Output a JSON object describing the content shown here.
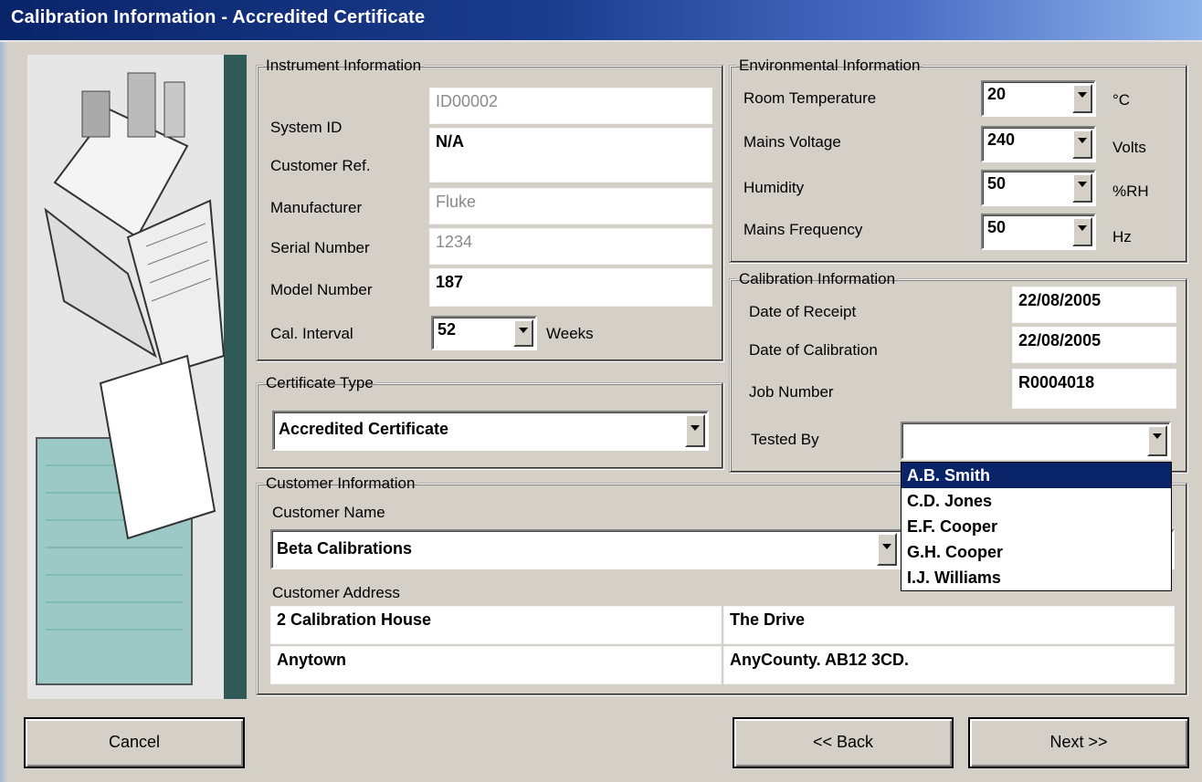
{
  "window": {
    "title": "Calibration Information - Accredited Certificate"
  },
  "instrument": {
    "legend": "Instrument Information",
    "system_id_label": "System ID",
    "system_id": "ID00002",
    "customer_ref_label": "Customer Ref.",
    "customer_ref": "N/A",
    "manufacturer_label": "Manufacturer",
    "manufacturer": "Fluke",
    "serial_label": "Serial Number",
    "serial": "1234",
    "model_label": "Model Number",
    "model": "187",
    "interval_label": "Cal. Interval",
    "interval": "52",
    "interval_unit": "Weeks"
  },
  "environment": {
    "legend": "Environmental Information",
    "temp_label": "Room Temperature",
    "temp": "20",
    "temp_unit": "°C",
    "voltage_label": "Mains Voltage",
    "voltage": "240",
    "voltage_unit": "Volts",
    "humidity_label": "Humidity",
    "humidity": "50",
    "humidity_unit": "%RH",
    "freq_label": "Mains Frequency",
    "freq": "50",
    "freq_unit": "Hz"
  },
  "calibration": {
    "legend": "Calibration Information",
    "receipt_label": "Date of Receipt",
    "receipt": "22/08/2005",
    "cal_date_label": "Date of Calibration",
    "cal_date": "22/08/2005",
    "job_label": "Job Number",
    "job": "R0004018",
    "tested_by_label": "Tested By",
    "tested_by": "",
    "tested_by_options": [
      "A.B. Smith",
      "C.D. Jones",
      "E.F. Cooper",
      "G.H. Cooper",
      "I.J. Williams"
    ],
    "selected_option": "A.B. Smith"
  },
  "certificate": {
    "legend": "Certificate Type",
    "type": "Accredited Certificate"
  },
  "customer": {
    "legend": "Customer Information",
    "name_label": "Customer Name",
    "name": "Beta Calibrations",
    "address_label": "Customer Address",
    "address": [
      "2 Calibration House",
      "The Drive",
      "Anytown",
      "AnyCounty. AB12 3CD."
    ]
  },
  "buttons": {
    "cancel": "Cancel",
    "back": "<< Back",
    "next": "Next >>"
  }
}
